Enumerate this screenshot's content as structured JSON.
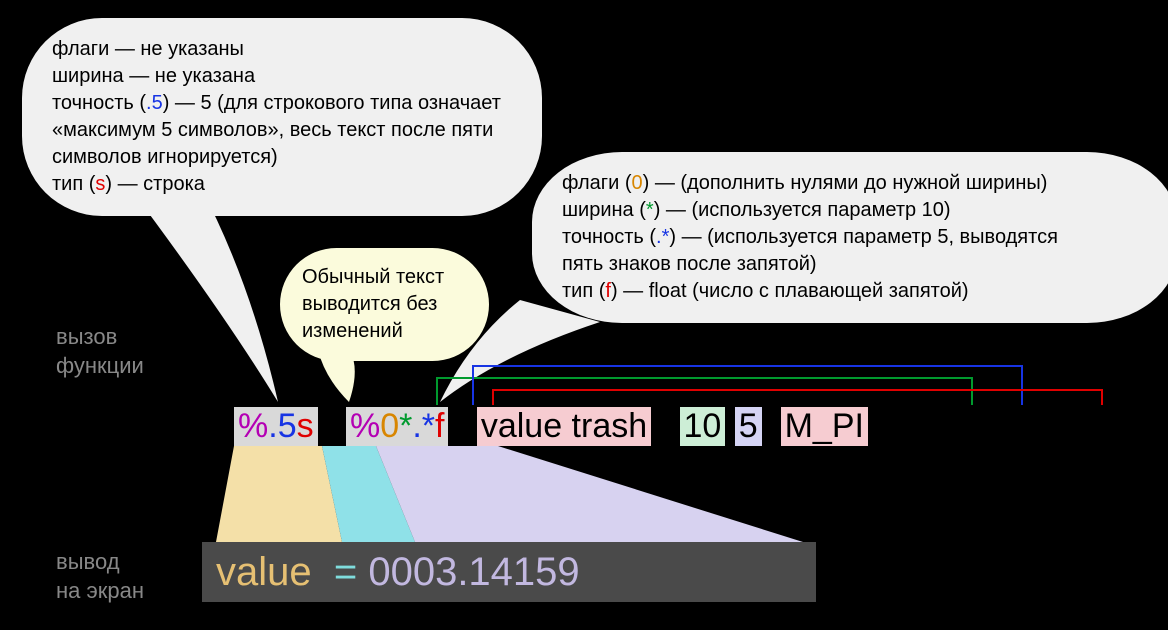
{
  "sideLabels": {
    "call1": "вызов",
    "call2": "функции",
    "out1": "вывод",
    "out2": "на экран"
  },
  "bubble1": {
    "l1a": "флаги — не указаны",
    "l2a": "ширина — не указана",
    "l3a": "точность (",
    "l3b": ".5",
    "l3c": ") — 5 (для строкового типа означает",
    "l4a": "«максимум 5 символов», весь текст после пяти",
    "l5a": "символов игнорируется)",
    "l6a": "тип (",
    "l6b": "s",
    "l6c": ") — строка"
  },
  "bubble2": {
    "l1": "Обычный текст",
    "l2": "выводится без",
    "l3": "изменений"
  },
  "bubble3": {
    "l1a": "флаги (",
    "l1b": "0",
    "l1c": ") — (дополнить нулями до нужной ширины)",
    "l2a": "ширина (",
    "l2b": "*",
    "l2c": ") — (используется параметр 10)",
    "l3a": "точность (",
    "l3b": ".*",
    "l3c": ") — (используется параметр 5, выводятся",
    "l4a": "пять знаков после запятой)",
    "l5a": "тип (",
    "l5b": "f",
    "l5c": ") — float (число с плавающей запятой)"
  },
  "fmt": {
    "tok1": {
      "pct": "%",
      "dot": ".",
      "five": "5",
      "s": "s"
    },
    "tok2": {
      "pct": "%",
      "zero": "0",
      "star": "*",
      "dot": ".",
      "star2": "*",
      "f": "f"
    },
    "arg_value": "value trash",
    "arg_10": "10",
    "arg_5": "5",
    "arg_mpi": "M_PI"
  },
  "output": {
    "part_value": "value",
    "part_eq": "  = ",
    "part_num": "0003.14159"
  },
  "colors": {
    "magenta": "#b400b4",
    "blue": "#1734e4",
    "red": "#e00000",
    "orange": "#d88600",
    "green": "#009a2e"
  }
}
